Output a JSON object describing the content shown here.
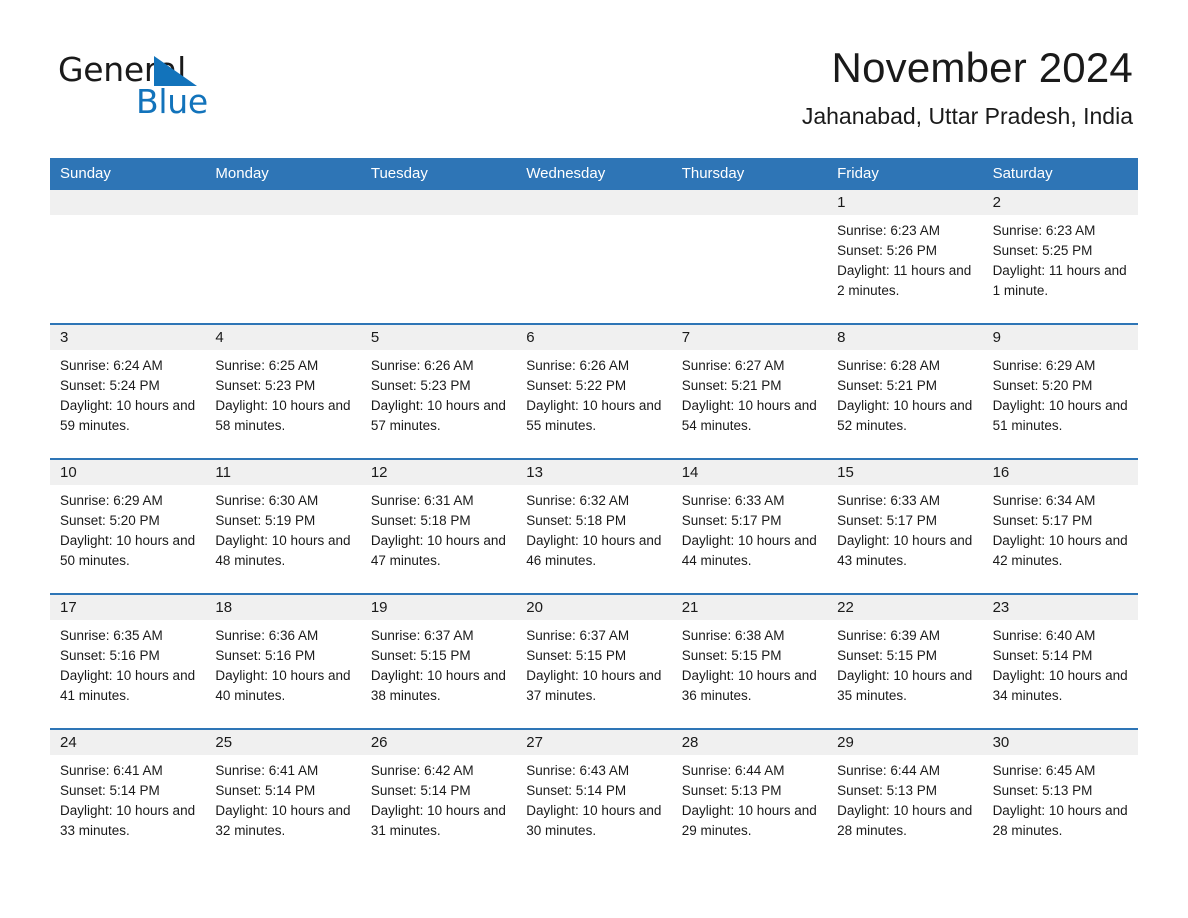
{
  "brand": {
    "name_part1": "General",
    "name_part2": "Blue",
    "accent_color": "#1273BB"
  },
  "header": {
    "title": "November 2024",
    "location": "Jahanabad, Uttar Pradesh, India"
  },
  "theme": {
    "header_blue": "#2E75B6",
    "daynum_band": "#F0F0F0",
    "text": "#1a1a1a"
  },
  "weekdays": [
    "Sunday",
    "Monday",
    "Tuesday",
    "Wednesday",
    "Thursday",
    "Friday",
    "Saturday"
  ],
  "weeks": [
    [
      {
        "day": "",
        "sunrise": "",
        "sunset": "",
        "daylight": "",
        "empty": true
      },
      {
        "day": "",
        "sunrise": "",
        "sunset": "",
        "daylight": "",
        "empty": true
      },
      {
        "day": "",
        "sunrise": "",
        "sunset": "",
        "daylight": "",
        "empty": true
      },
      {
        "day": "",
        "sunrise": "",
        "sunset": "",
        "daylight": "",
        "empty": true
      },
      {
        "day": "",
        "sunrise": "",
        "sunset": "",
        "daylight": "",
        "empty": true
      },
      {
        "day": "1",
        "sunrise": "Sunrise: 6:23 AM",
        "sunset": "Sunset: 5:26 PM",
        "daylight": "Daylight: 11 hours and 2 minutes.",
        "empty": false
      },
      {
        "day": "2",
        "sunrise": "Sunrise: 6:23 AM",
        "sunset": "Sunset: 5:25 PM",
        "daylight": "Daylight: 11 hours and 1 minute.",
        "empty": false
      }
    ],
    [
      {
        "day": "3",
        "sunrise": "Sunrise: 6:24 AM",
        "sunset": "Sunset: 5:24 PM",
        "daylight": "Daylight: 10 hours and 59 minutes.",
        "empty": false
      },
      {
        "day": "4",
        "sunrise": "Sunrise: 6:25 AM",
        "sunset": "Sunset: 5:23 PM",
        "daylight": "Daylight: 10 hours and 58 minutes.",
        "empty": false
      },
      {
        "day": "5",
        "sunrise": "Sunrise: 6:26 AM",
        "sunset": "Sunset: 5:23 PM",
        "daylight": "Daylight: 10 hours and 57 minutes.",
        "empty": false
      },
      {
        "day": "6",
        "sunrise": "Sunrise: 6:26 AM",
        "sunset": "Sunset: 5:22 PM",
        "daylight": "Daylight: 10 hours and 55 minutes.",
        "empty": false
      },
      {
        "day": "7",
        "sunrise": "Sunrise: 6:27 AM",
        "sunset": "Sunset: 5:21 PM",
        "daylight": "Daylight: 10 hours and 54 minutes.",
        "empty": false
      },
      {
        "day": "8",
        "sunrise": "Sunrise: 6:28 AM",
        "sunset": "Sunset: 5:21 PM",
        "daylight": "Daylight: 10 hours and 52 minutes.",
        "empty": false
      },
      {
        "day": "9",
        "sunrise": "Sunrise: 6:29 AM",
        "sunset": "Sunset: 5:20 PM",
        "daylight": "Daylight: 10 hours and 51 minutes.",
        "empty": false
      }
    ],
    [
      {
        "day": "10",
        "sunrise": "Sunrise: 6:29 AM",
        "sunset": "Sunset: 5:20 PM",
        "daylight": "Daylight: 10 hours and 50 minutes.",
        "empty": false
      },
      {
        "day": "11",
        "sunrise": "Sunrise: 6:30 AM",
        "sunset": "Sunset: 5:19 PM",
        "daylight": "Daylight: 10 hours and 48 minutes.",
        "empty": false
      },
      {
        "day": "12",
        "sunrise": "Sunrise: 6:31 AM",
        "sunset": "Sunset: 5:18 PM",
        "daylight": "Daylight: 10 hours and 47 minutes.",
        "empty": false
      },
      {
        "day": "13",
        "sunrise": "Sunrise: 6:32 AM",
        "sunset": "Sunset: 5:18 PM",
        "daylight": "Daylight: 10 hours and 46 minutes.",
        "empty": false
      },
      {
        "day": "14",
        "sunrise": "Sunrise: 6:33 AM",
        "sunset": "Sunset: 5:17 PM",
        "daylight": "Daylight: 10 hours and 44 minutes.",
        "empty": false
      },
      {
        "day": "15",
        "sunrise": "Sunrise: 6:33 AM",
        "sunset": "Sunset: 5:17 PM",
        "daylight": "Daylight: 10 hours and 43 minutes.",
        "empty": false
      },
      {
        "day": "16",
        "sunrise": "Sunrise: 6:34 AM",
        "sunset": "Sunset: 5:17 PM",
        "daylight": "Daylight: 10 hours and 42 minutes.",
        "empty": false
      }
    ],
    [
      {
        "day": "17",
        "sunrise": "Sunrise: 6:35 AM",
        "sunset": "Sunset: 5:16 PM",
        "daylight": "Daylight: 10 hours and 41 minutes.",
        "empty": false
      },
      {
        "day": "18",
        "sunrise": "Sunrise: 6:36 AM",
        "sunset": "Sunset: 5:16 PM",
        "daylight": "Daylight: 10 hours and 40 minutes.",
        "empty": false
      },
      {
        "day": "19",
        "sunrise": "Sunrise: 6:37 AM",
        "sunset": "Sunset: 5:15 PM",
        "daylight": "Daylight: 10 hours and 38 minutes.",
        "empty": false
      },
      {
        "day": "20",
        "sunrise": "Sunrise: 6:37 AM",
        "sunset": "Sunset: 5:15 PM",
        "daylight": "Daylight: 10 hours and 37 minutes.",
        "empty": false
      },
      {
        "day": "21",
        "sunrise": "Sunrise: 6:38 AM",
        "sunset": "Sunset: 5:15 PM",
        "daylight": "Daylight: 10 hours and 36 minutes.",
        "empty": false
      },
      {
        "day": "22",
        "sunrise": "Sunrise: 6:39 AM",
        "sunset": "Sunset: 5:15 PM",
        "daylight": "Daylight: 10 hours and 35 minutes.",
        "empty": false
      },
      {
        "day": "23",
        "sunrise": "Sunrise: 6:40 AM",
        "sunset": "Sunset: 5:14 PM",
        "daylight": "Daylight: 10 hours and 34 minutes.",
        "empty": false
      }
    ],
    [
      {
        "day": "24",
        "sunrise": "Sunrise: 6:41 AM",
        "sunset": "Sunset: 5:14 PM",
        "daylight": "Daylight: 10 hours and 33 minutes.",
        "empty": false
      },
      {
        "day": "25",
        "sunrise": "Sunrise: 6:41 AM",
        "sunset": "Sunset: 5:14 PM",
        "daylight": "Daylight: 10 hours and 32 minutes.",
        "empty": false
      },
      {
        "day": "26",
        "sunrise": "Sunrise: 6:42 AM",
        "sunset": "Sunset: 5:14 PM",
        "daylight": "Daylight: 10 hours and 31 minutes.",
        "empty": false
      },
      {
        "day": "27",
        "sunrise": "Sunrise: 6:43 AM",
        "sunset": "Sunset: 5:14 PM",
        "daylight": "Daylight: 10 hours and 30 minutes.",
        "empty": false
      },
      {
        "day": "28",
        "sunrise": "Sunrise: 6:44 AM",
        "sunset": "Sunset: 5:13 PM",
        "daylight": "Daylight: 10 hours and 29 minutes.",
        "empty": false
      },
      {
        "day": "29",
        "sunrise": "Sunrise: 6:44 AM",
        "sunset": "Sunset: 5:13 PM",
        "daylight": "Daylight: 10 hours and 28 minutes.",
        "empty": false
      },
      {
        "day": "30",
        "sunrise": "Sunrise: 6:45 AM",
        "sunset": "Sunset: 5:13 PM",
        "daylight": "Daylight: 10 hours and 28 minutes.",
        "empty": false
      }
    ]
  ]
}
